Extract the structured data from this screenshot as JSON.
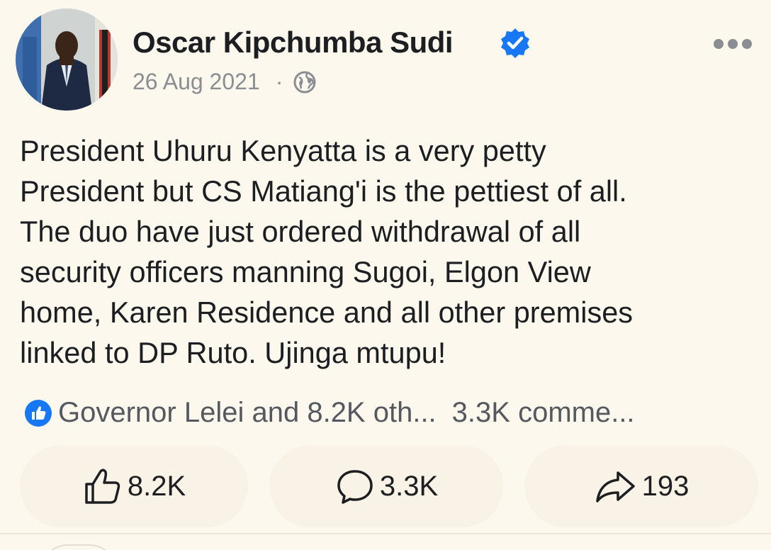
{
  "post": {
    "author_name": "Oscar Kipchumba Sudi",
    "date": "26 Aug 2021",
    "separator": "·",
    "audience_icon": "globe-icon",
    "verified_icon": "verified-badge-icon",
    "more_icon": "more-horizontal-icon",
    "body_lines": [
      "President Uhuru Kenyatta is a very petty",
      "President but CS Matiang'i is the pettiest of all.",
      "The duo have just ordered withdrawal of all",
      "security officers manning Sugoi, Elgon View",
      "home, Karen Residence and all other premises",
      "linked to DP Ruto. Ujinga mtupu!"
    ],
    "reactions_summary": "Governor Lelei and 8.2K oth...",
    "comments_summary": "3.3K comme...",
    "actions": {
      "like_count": "8.2K",
      "comment_count": "3.3K",
      "share_count": "193"
    }
  },
  "colors": {
    "background": "#fcf8ee",
    "accent_blue": "#1877f2",
    "text": "#1c1e21",
    "muted": "#8a8d91"
  }
}
